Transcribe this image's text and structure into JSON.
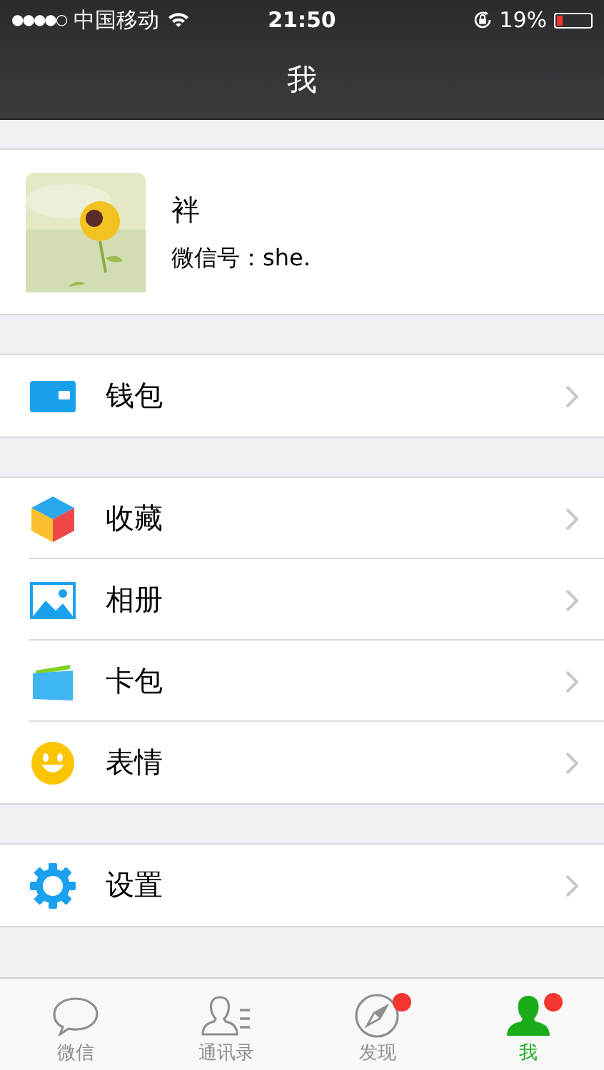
{
  "status_bar": {
    "signal_dots": "●●●●○",
    "carrier": "中国移动",
    "time": "21:50",
    "battery": "19%"
  },
  "nav": {
    "title": "我"
  },
  "profile": {
    "name": "袢",
    "wechat_id": "微信号：she."
  },
  "groups": [
    [
      {
        "label": "钱包",
        "kind": "wallet"
      }
    ],
    [
      {
        "label": "收藏",
        "kind": "favorites"
      },
      {
        "label": "相册",
        "kind": "album"
      },
      {
        "label": "卡包",
        "kind": "cards"
      },
      {
        "label": "表情",
        "kind": "stickers"
      }
    ],
    [
      {
        "label": "设置",
        "kind": "settings"
      }
    ]
  ],
  "tabs": [
    {
      "label": "微信",
      "kind": "chats",
      "selected": false,
      "badge": false
    },
    {
      "label": "通讯录",
      "kind": "contacts",
      "selected": false,
      "badge": false
    },
    {
      "label": "发现",
      "kind": "discover",
      "selected": false,
      "badge": true
    },
    {
      "label": "我",
      "kind": "me",
      "selected": true,
      "badge": true
    }
  ]
}
